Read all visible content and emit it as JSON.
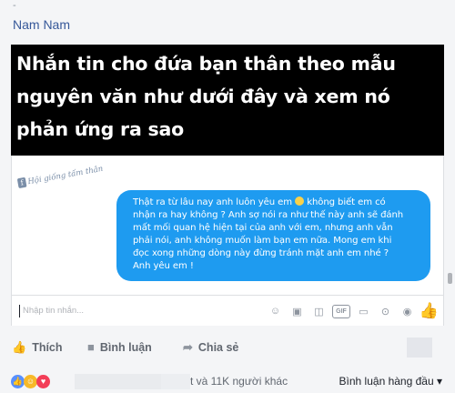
{
  "post": {
    "top_mark": "-",
    "author": "Nam Nam",
    "headline_lines": [
      "Nhắn tin cho đứa bạn thân theo mẫu",
      "nguyên văn như dưới đây và xem nó",
      "phản ứng ra sao"
    ]
  },
  "chat": {
    "stamp_letter": "f",
    "stamp_text": "Hội giống tấm thân",
    "message_lines": [
      "Thật ra từ lâu nay anh luôn yêu em",
      " không biết em có",
      "nhận ra hay không ? Anh sợ nói ra như thế này anh sẽ đánh",
      "mất mối quan hệ hiện tại của anh với em, nhưng anh vẫn",
      "phải nói, anh không muốn làm bạn em nữa. Mong em khi",
      "đọc xong những dòng này đừng tránh mặt anh em nhé ?",
      "Anh yêu em !"
    ],
    "composer_placeholder": "Nhập tin nhắn...",
    "tool_icons": [
      "emoji-icon",
      "sticker-icon",
      "gif-icon",
      "payment-icon",
      "location-icon",
      "camera-icon",
      "like-icon"
    ],
    "gif_label": "GIF"
  },
  "actions": {
    "like_label": "Thích",
    "comment_label": "Bình luận",
    "share_label": "Chia sẻ"
  },
  "reactions": {
    "summary": "t và 11K người khác",
    "sort_label": "Bình luận hàng đầu"
  },
  "colors": {
    "accent": "#365899",
    "bubble": "#1e9bf0",
    "like_blue": "#5890ff",
    "haha_yellow": "#f7b928",
    "love_red": "#f33e58"
  }
}
